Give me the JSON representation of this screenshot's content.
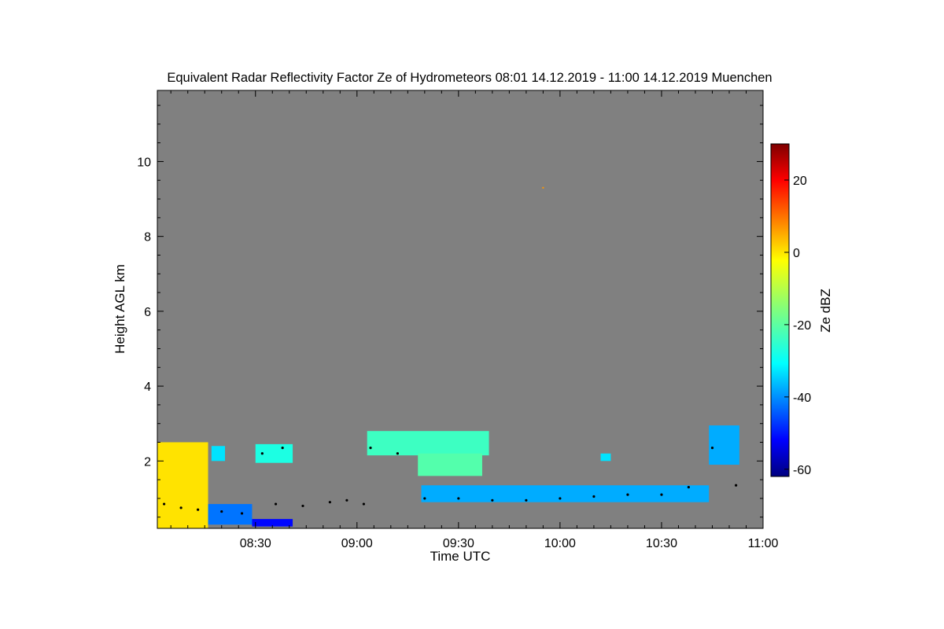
{
  "chart_data": {
    "type": "heatmap",
    "title": "Equivalent Radar Reflectivity Factor Ze of Hydrometeors   08:01 14.12.2019 - 11:00 14.12.2019 Muenchen",
    "xlabel": "Time UTC",
    "ylabel": "Height AGL km",
    "colorbar_label": "Ze dBZ",
    "x_unit": "minutes since 08:00 UTC",
    "xlim": [
      1,
      180
    ],
    "ylim": [
      0.2,
      11.9
    ],
    "x_ticks": [
      {
        "value": 30,
        "label": "08:30"
      },
      {
        "value": 60,
        "label": "09:00"
      },
      {
        "value": 90,
        "label": "09:30"
      },
      {
        "value": 120,
        "label": "10:00"
      },
      {
        "value": 150,
        "label": "10:30"
      },
      {
        "value": 180,
        "label": "11:00"
      }
    ],
    "y_ticks": [
      {
        "value": 2,
        "label": "2"
      },
      {
        "value": 4,
        "label": "4"
      },
      {
        "value": 6,
        "label": "6"
      },
      {
        "value": 8,
        "label": "8"
      },
      {
        "value": 10,
        "label": "10"
      }
    ],
    "colorbar": {
      "range": [
        -62,
        30
      ],
      "ticks": [
        {
          "value": -60,
          "label": "-60"
        },
        {
          "value": -40,
          "label": "-40"
        },
        {
          "value": -20,
          "label": "-20"
        },
        {
          "value": 0,
          "label": "0"
        },
        {
          "value": 20,
          "label": "20"
        }
      ],
      "colormap": "jet"
    },
    "background_color": "#808080",
    "echo_regions": [
      {
        "x0": 1,
        "x1": 16,
        "y0": 0.2,
        "y1": 2.5,
        "ze": -2
      },
      {
        "x0": 16,
        "x1": 29,
        "y0": 0.3,
        "y1": 0.85,
        "ze": -40
      },
      {
        "x0": 29,
        "x1": 41,
        "y0": 0.25,
        "y1": 0.45,
        "ze": -50
      },
      {
        "x0": 17,
        "x1": 21,
        "y0": 2.0,
        "y1": 2.4,
        "ze": -30
      },
      {
        "x0": 30,
        "x1": 41,
        "y0": 1.95,
        "y1": 2.45,
        "ze": -25
      },
      {
        "x0": 63,
        "x1": 99,
        "y0": 2.15,
        "y1": 2.8,
        "ze": -22
      },
      {
        "x0": 78,
        "x1": 97,
        "y0": 1.6,
        "y1": 2.2,
        "ze": -20
      },
      {
        "x0": 79,
        "x1": 164,
        "y0": 0.9,
        "y1": 1.35,
        "ze": -35
      },
      {
        "x0": 164,
        "x1": 173,
        "y0": 1.9,
        "y1": 2.95,
        "ze": -35
      },
      {
        "x0": 132,
        "x1": 135,
        "y0": 2.0,
        "y1": 2.2,
        "ze": -30
      }
    ],
    "cloud_base_points": [
      [
        3,
        0.85
      ],
      [
        8,
        0.75
      ],
      [
        13,
        0.7
      ],
      [
        20,
        0.65
      ],
      [
        26,
        0.6
      ],
      [
        36,
        0.85
      ],
      [
        44,
        0.8
      ],
      [
        52,
        0.9
      ],
      [
        57,
        0.95
      ],
      [
        62,
        0.85
      ],
      [
        32,
        2.2
      ],
      [
        38,
        2.35
      ],
      [
        64,
        2.35
      ],
      [
        72,
        2.2
      ],
      [
        80,
        1.0
      ],
      [
        90,
        1.0
      ],
      [
        100,
        0.95
      ],
      [
        110,
        0.95
      ],
      [
        120,
        1.0
      ],
      [
        130,
        1.05
      ],
      [
        140,
        1.1
      ],
      [
        150,
        1.1
      ],
      [
        158,
        1.3
      ],
      [
        165,
        2.35
      ],
      [
        172,
        1.35
      ]
    ],
    "single_pixel": [
      {
        "x": 115,
        "y": 9.3,
        "ze": 5
      }
    ]
  }
}
